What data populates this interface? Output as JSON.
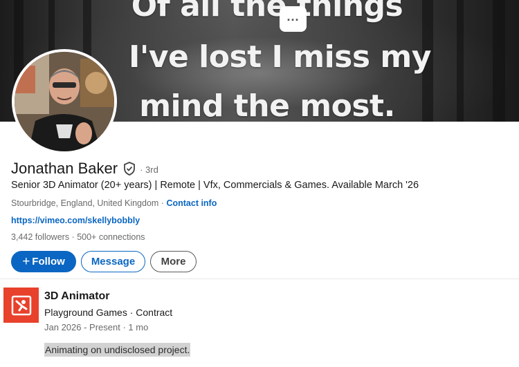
{
  "banner": {
    "lines": [
      "Of all the things",
      "I've lost I miss my",
      "mind the most."
    ]
  },
  "more_menu": {
    "label": "..."
  },
  "profile": {
    "name": "Jonathan Baker",
    "degree": "· 3rd",
    "headline": "Senior 3D Animator (20+ years) | Remote | Vfx, Commercials & Games. Available March '26",
    "location": "Stourbridge, England, United Kingdom ·",
    "contact_info": "Contact info",
    "website": "https://vimeo.com/skellybobbly",
    "followers": "3,442 followers",
    "connections": "500+ connections"
  },
  "actions": {
    "follow_plus": "+",
    "follow": "Follow",
    "message": "Message",
    "more": "More"
  },
  "experience": {
    "title": "3D Animator",
    "company": "Playground Games · Contract",
    "dates": "Jan 2026 - Present · 1 mo",
    "description": "Animating on undisclosed project."
  },
  "colors": {
    "linkedin_blue": "#0a66c2",
    "company_logo_bg": "#e8412c"
  },
  "icons": [
    "more-horizontal-icon",
    "verified-shield-icon",
    "company-logo-icon"
  ]
}
